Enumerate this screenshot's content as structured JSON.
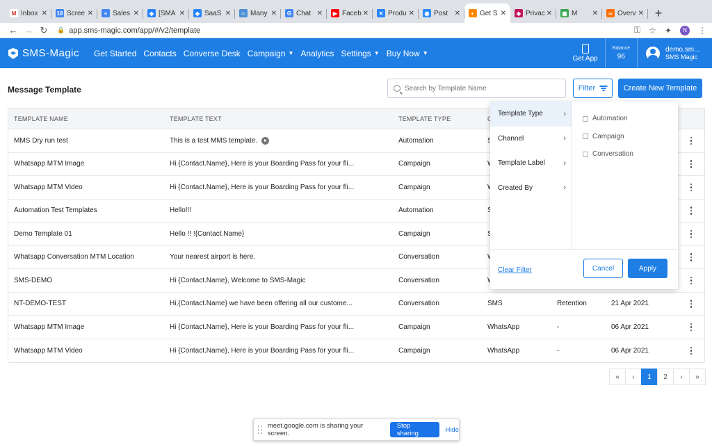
{
  "browser": {
    "tabs": [
      {
        "label": "Inbox",
        "color": "#ffffff",
        "glyph": "M",
        "glyph_color": "#d93025"
      },
      {
        "label": "Scree",
        "color": "#4285f4",
        "glyph": "18"
      },
      {
        "label": "Sales",
        "color": "#4285f4",
        "glyph": "≡"
      },
      {
        "label": "[SMA",
        "color": "#2684ff",
        "glyph": "◆"
      },
      {
        "label": "SaaS",
        "color": "#2684ff",
        "glyph": "◆"
      },
      {
        "label": "Many",
        "color": "#4a90d9",
        "glyph": "☺"
      },
      {
        "label": "Chat",
        "color": "#4285f4",
        "glyph": "G"
      },
      {
        "label": "Faceb",
        "color": "#ff0000",
        "glyph": "▶"
      },
      {
        "label": "Produ",
        "color": "#2684ff",
        "glyph": "✕"
      },
      {
        "label": "Post",
        "color": "#2d8cff",
        "glyph": "◉"
      },
      {
        "label": "Get S",
        "color": "#ff8a00",
        "glyph": "◐",
        "active": true
      },
      {
        "label": "Privac",
        "color": "#c2185b",
        "glyph": "◈"
      },
      {
        "label": "M",
        "color": "#34a853",
        "glyph": "▣"
      },
      {
        "label": "Overv",
        "color": "#ff6f00",
        "glyph": "∞"
      }
    ],
    "url": "app.sms-magic.com/app/#/v2/template",
    "profile_initial": "N"
  },
  "app": {
    "logo_text": "SMS-Magic",
    "menu": [
      {
        "label": "Get Started",
        "caret": false
      },
      {
        "label": "Contacts",
        "caret": false
      },
      {
        "label": "Converse Desk",
        "caret": false
      },
      {
        "label": "Campaign",
        "caret": true
      },
      {
        "label": "Analytics",
        "caret": false
      },
      {
        "label": "Settings",
        "caret": true
      },
      {
        "label": "Buy Now",
        "caret": true
      }
    ],
    "get_app_label": "Get App",
    "balance_label": "Balance",
    "balance_value": "96",
    "user_name": "demo.sm...",
    "user_org": "SMS Magic"
  },
  "page": {
    "title": "Message Template",
    "search_placeholder": "Search by Template Name",
    "filter_label": "Filter",
    "create_label": "Create New Template"
  },
  "table": {
    "headers": [
      "TEMPLATE NAME",
      "TEMPLATE TEXT",
      "TEMPLATE TYPE",
      "C"
    ],
    "rows": [
      {
        "name": "MMS Dry run test",
        "text": "This is a test MMS template.",
        "type": "Automation",
        "channel": "S",
        "label": "",
        "date": "",
        "play": true
      },
      {
        "name": "Whatsapp MTM Image",
        "text": "Hi {Contact.Name}, Here is your Boarding Pass for your fli...",
        "type": "Campaign",
        "channel": "W",
        "label": "",
        "date": ""
      },
      {
        "name": "Whatsapp MTM Video",
        "text": "Hi {Contact.Name}, Here is your Boarding Pass for your fli...",
        "type": "Campaign",
        "channel": "W",
        "label": "",
        "date": ""
      },
      {
        "name": "Automation Test Templates",
        "text": "Hello!!!",
        "type": "Automation",
        "channel": "S",
        "label": "",
        "date": ""
      },
      {
        "name": "Demo Template 01",
        "text": "Hello !! !{Contact.Name}",
        "type": "Campaign",
        "channel": "S",
        "label": "",
        "date": ""
      },
      {
        "name": "Whatsapp Conversation MTM Location",
        "text": "Your nearest airport is here.",
        "type": "Conversation",
        "channel": "W",
        "label": "",
        "date": ""
      },
      {
        "name": "SMS-DEMO",
        "text": "Hi {Contact.Name}, Welcome to SMS-Magic",
        "type": "Conversation",
        "channel": "W",
        "label": "",
        "date": ""
      },
      {
        "name": "NT-DEMO-TEST",
        "text": "Hi,{Contact.Name} we have been offering all our custome...",
        "type": "Conversation",
        "channel": "SMS",
        "label": "Retention",
        "date": "21 Apr 2021"
      },
      {
        "name": "Whatsapp MTM Image",
        "text": "Hi {Contact.Name}, Here is your Boarding Pass for your fli...",
        "type": "Campaign",
        "channel": "WhatsApp",
        "label": "-",
        "date": "06 Apr 2021"
      },
      {
        "name": "Whatsapp MTM Video",
        "text": "Hi {Contact.Name}, Here is your Boarding Pass for your fli...",
        "type": "Campaign",
        "channel": "WhatsApp",
        "label": "-",
        "date": "06 Apr 2021"
      }
    ]
  },
  "filter_panel": {
    "categories": [
      {
        "label": "Template Type",
        "active": true
      },
      {
        "label": "Channel"
      },
      {
        "label": "Template Label"
      },
      {
        "label": "Created By"
      }
    ],
    "options": [
      "Automation",
      "Campaign",
      "Conversation"
    ],
    "clear_label": "Clear Filter",
    "cancel_label": "Cancel",
    "apply_label": "Apply"
  },
  "pagination": {
    "items": [
      "«",
      "‹",
      "1",
      "2",
      "›",
      "»"
    ],
    "current": "1"
  },
  "share_bar": {
    "message": "meet.google.com is sharing your screen.",
    "stop_label": "Stop sharing",
    "hide_label": "Hide"
  },
  "colors": {
    "primary": "#1e7ee4"
  }
}
